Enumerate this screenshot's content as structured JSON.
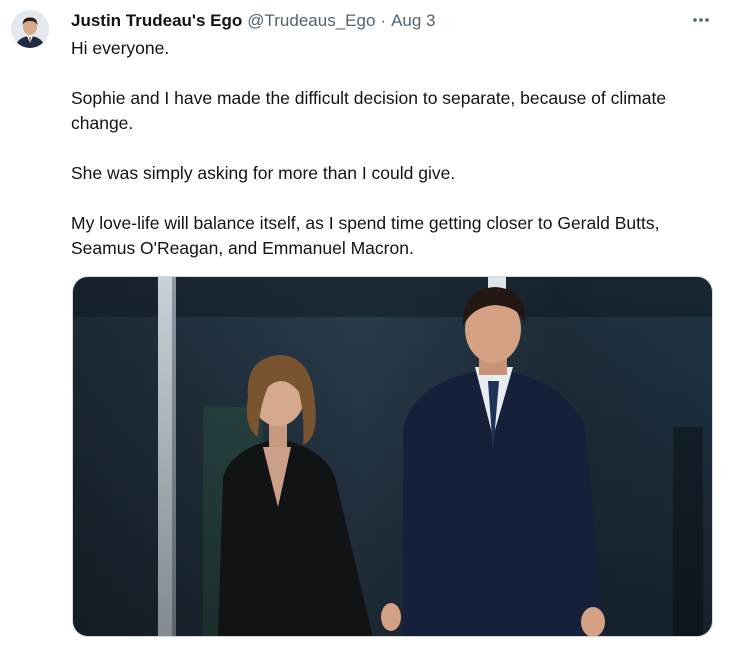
{
  "tweet": {
    "display_name": "Justin Trudeau's Ego",
    "handle": "@Trudeaus_Ego",
    "separator": "·",
    "timestamp": "Aug 3",
    "more_icon": "more-horizontal-icon",
    "paragraphs": [
      "Hi everyone.",
      "Sophie and I have made the difficult decision to separate, because of climate change.",
      "She was simply asking for more than I could give.",
      "My love-life will balance itself, as I spend time getting closer to Gerald Butts, Seamus O'Reagan, and Emmanuel Macron."
    ]
  },
  "colors": {
    "text_primary": "#0f1419",
    "text_secondary": "#536471",
    "border": "#cfd9de",
    "background": "#ffffff"
  }
}
